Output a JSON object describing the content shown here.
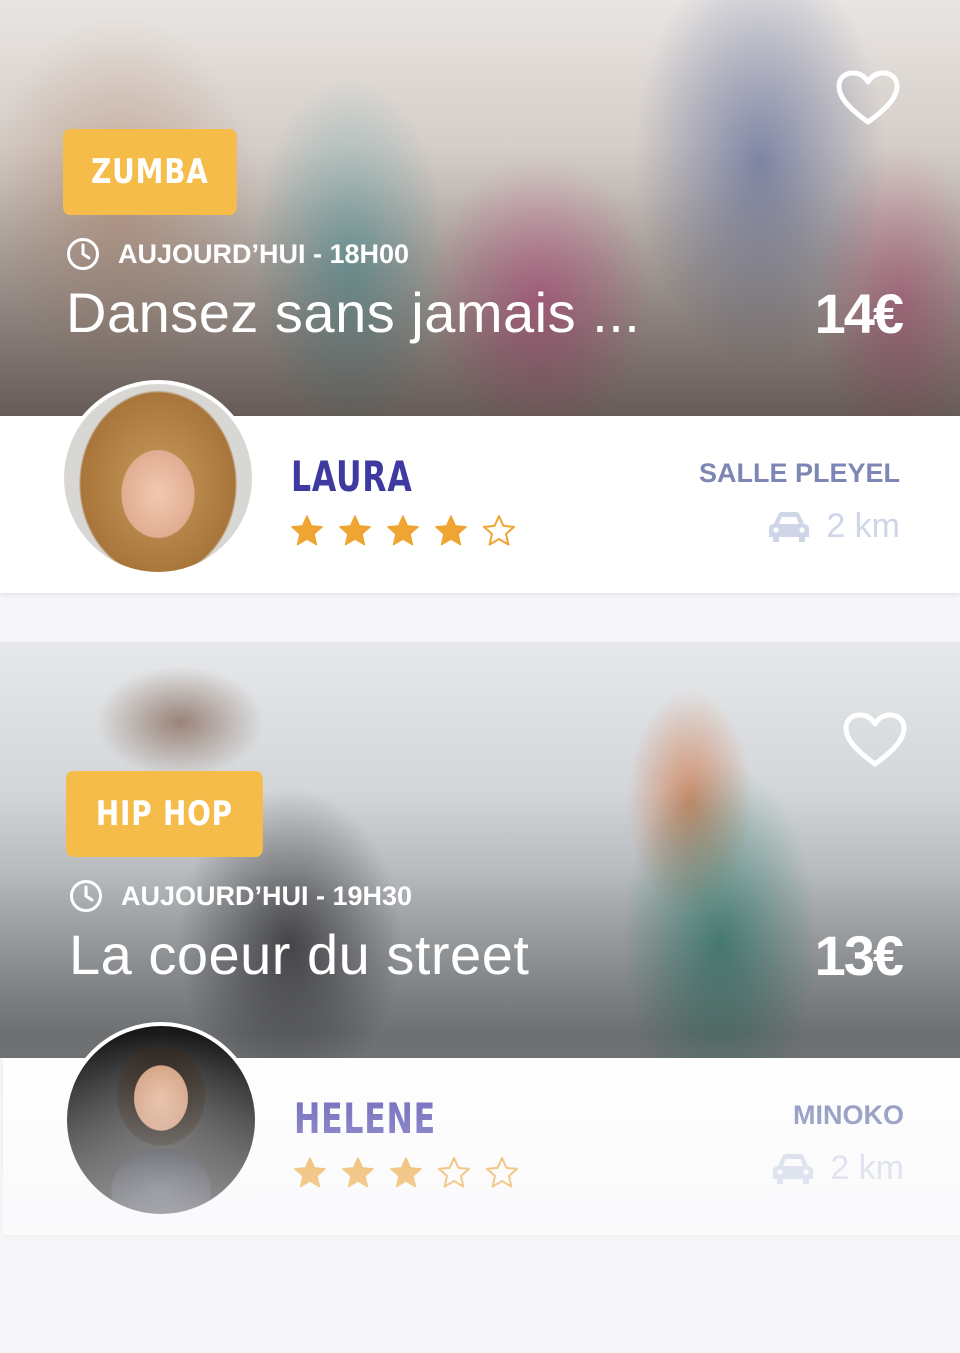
{
  "cards": [
    {
      "category": "ZUMBA",
      "time": "AUJOURD’HUI - 18H00",
      "title": "Dansez sans jamais ...",
      "price": "14€",
      "teacher": "LAURA",
      "rating": 4,
      "venue": "SALLE PLEYEL",
      "distance": "2 km"
    },
    {
      "category": "HIP HOP",
      "time": "AUJOURD’HUI - 19H30",
      "title": "La coeur du street",
      "price": "13€",
      "teacher": "HELENE",
      "rating": 3,
      "venue": "MINOKO",
      "distance": "2 km"
    }
  ],
  "icons": {
    "favorite": "heart-outline-icon",
    "time": "clock-icon",
    "rating": "star-icon",
    "transport": "car-icon"
  },
  "colors": {
    "badge": "#f5bc4a",
    "teacher_name": "#3e3aa0",
    "venue": "#7e86b5",
    "star": "#f0a431",
    "distance": "#cfd6e8",
    "background": "#f6f6f9"
  }
}
